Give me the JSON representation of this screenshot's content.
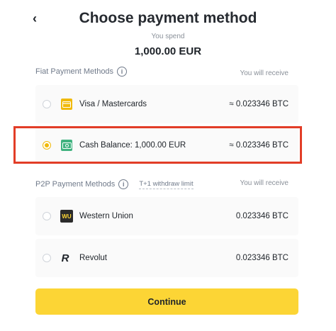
{
  "header": {
    "back_glyph": "‹",
    "title": "Choose payment method",
    "spend_label": "You spend",
    "spend_amount": "1,000.00 EUR"
  },
  "fiat_section": {
    "label": "Fiat Payment Methods",
    "receive_label": "You will receive",
    "methods": [
      {
        "name": "Visa / Mastercards",
        "amount": "≈ 0.023346 BTC",
        "icon": "credit-card-icon",
        "selected": false
      },
      {
        "name": "Cash Balance: 1,000.00 EUR",
        "amount": "≈ 0.023346 BTC",
        "icon": "cash-icon",
        "selected": true
      }
    ]
  },
  "p2p_section": {
    "label": "P2P Payment Methods",
    "limit_label": "T+1  withdraw limit",
    "receive_label": "You will receive",
    "methods": [
      {
        "name": "Western Union",
        "amount": "0.023346 BTC",
        "icon": "western-union-icon",
        "icon_text": "WU",
        "selected": false
      },
      {
        "name": "Revolut",
        "amount": "0.023346 BTC",
        "icon": "revolut-icon",
        "icon_text": "R",
        "selected": false
      }
    ]
  },
  "footer": {
    "continue_label": "Continue"
  },
  "colors": {
    "accent": "#fcd535",
    "radio_selected": "#f0b90b",
    "highlight": "#e23d27"
  }
}
